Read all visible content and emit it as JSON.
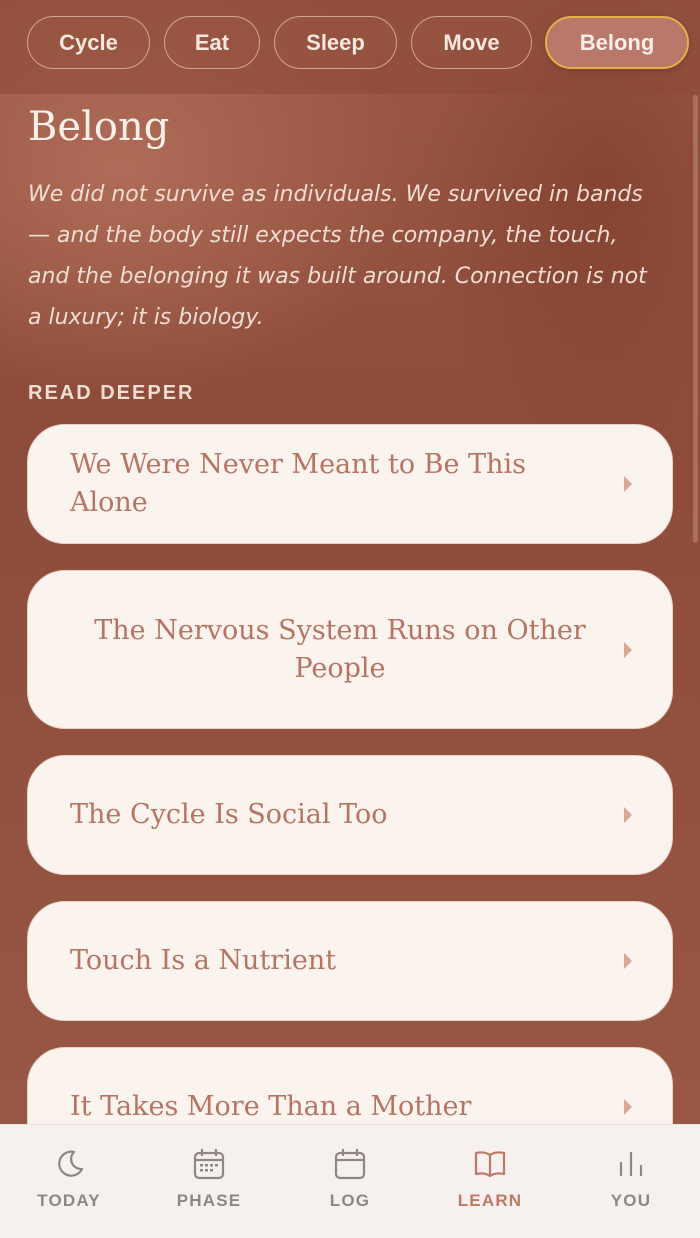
{
  "nav": {
    "pills": [
      {
        "label": "Cycle"
      },
      {
        "label": "Eat"
      },
      {
        "label": "Sleep"
      },
      {
        "label": "Move"
      },
      {
        "label": "Belong"
      }
    ],
    "active": "Belong"
  },
  "page": {
    "title": "Belong",
    "intro": "We did not survive as individuals. We survived in bands — and the body still expects the company, the touch, and the belonging it was built around. Connection is not a luxury; it is biology.",
    "section_label": "READ DEEPER"
  },
  "articles": [
    {
      "title": "We Were Never Meant to Be This Alone"
    },
    {
      "title": "The Nervous System Runs on Other People"
    },
    {
      "title": "The Cycle Is Social Too"
    },
    {
      "title": "Touch Is a Nutrient"
    },
    {
      "title": "It Takes More Than a Mother"
    }
  ],
  "tabbar": {
    "tabs": [
      {
        "label": "TODAY",
        "icon": "moon-icon"
      },
      {
        "label": "PHASE",
        "icon": "calendar-grid-icon"
      },
      {
        "label": "LOG",
        "icon": "calendar-icon"
      },
      {
        "label": "LEARN",
        "icon": "book-icon"
      },
      {
        "label": "YOU",
        "icon": "bar-chart-icon"
      }
    ],
    "active": "LEARN"
  },
  "colors": {
    "background": "#9b5845",
    "card": "#faf3ee",
    "card_text": "#b67463",
    "active_pill_border": "#e3b04a",
    "active_tab": "#c07866",
    "inactive_tab": "#8e8783"
  }
}
